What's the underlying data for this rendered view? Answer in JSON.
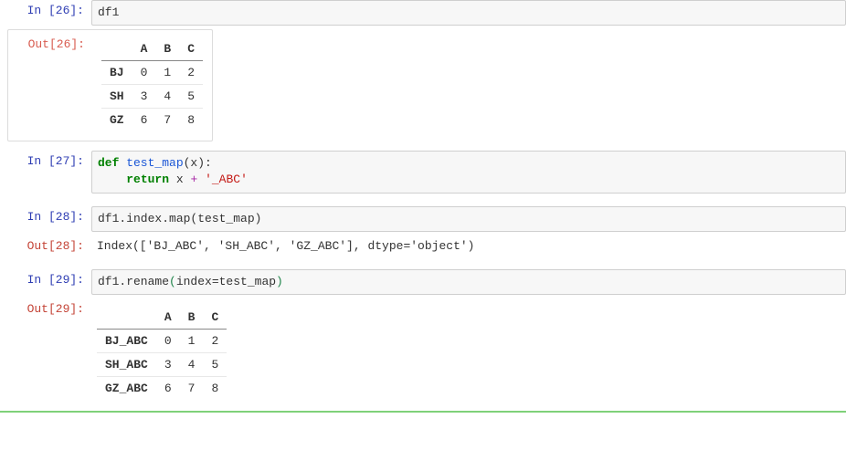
{
  "cells": {
    "c26": {
      "in_prompt": "In  [26]:",
      "out_prompt": "Out[26]:",
      "code": "df1",
      "table": {
        "columns": [
          "A",
          "B",
          "C"
        ],
        "rows": [
          {
            "idx": "BJ",
            "vals": [
              "0",
              "1",
              "2"
            ]
          },
          {
            "idx": "SH",
            "vals": [
              "3",
              "4",
              "5"
            ]
          },
          {
            "idx": "GZ",
            "vals": [
              "6",
              "7",
              "8"
            ]
          }
        ]
      }
    },
    "c27": {
      "in_prompt": "In  [27]:",
      "def_kw": "def",
      "fn_name": " test_map",
      "fn_sig": "(x):",
      "ret_kw": "return",
      "ret_body1": " x ",
      "ret_op": "+",
      "ret_body2": " ",
      "ret_str": "'_ABC'"
    },
    "c28": {
      "in_prompt": "In  [28]:",
      "out_prompt": "Out[28]:",
      "code": "df1.index.map(test_map)",
      "output": "Index(['BJ_ABC', 'SH_ABC', 'GZ_ABC'], dtype='object')"
    },
    "c29": {
      "in_prompt": "In  [29]:",
      "out_prompt": "Out[29]:",
      "code_pre": "df1.rename",
      "code_paren_open": "(",
      "code_mid": "index=test_map",
      "code_paren_close": ")",
      "table": {
        "columns": [
          "A",
          "B",
          "C"
        ],
        "rows": [
          {
            "idx": "BJ_ABC",
            "vals": [
              "0",
              "1",
              "2"
            ]
          },
          {
            "idx": "SH_ABC",
            "vals": [
              "3",
              "4",
              "5"
            ]
          },
          {
            "idx": "GZ_ABC",
            "vals": [
              "6",
              "7",
              "8"
            ]
          }
        ]
      }
    }
  }
}
